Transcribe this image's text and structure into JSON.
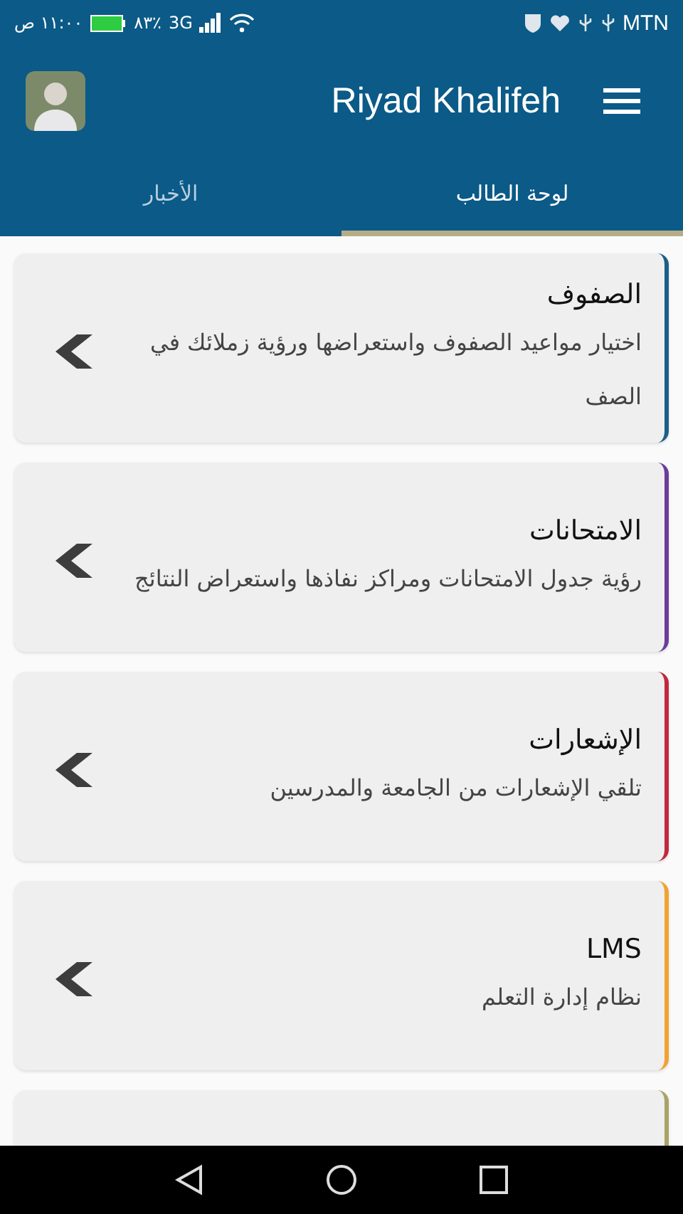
{
  "status_bar": {
    "time": "١١:٠٠ ص",
    "battery": "٨٣٪",
    "network": "3G",
    "carrier": "MTN"
  },
  "header": {
    "title": "Riyad Khalifeh"
  },
  "tabs": [
    {
      "label": "لوحة الطالب",
      "selected": true
    },
    {
      "label": "الأخبار",
      "selected": false
    }
  ],
  "cards": [
    {
      "title": "الصفوف",
      "description": "اختيار مواعيد الصفوف واستعراضها ورؤية زملائك في الصف",
      "color": "#1b5f87"
    },
    {
      "title": "الامتحانات",
      "description": "رؤية جدول الامتحانات ومراكز نفاذها واستعراض النتائج",
      "color": "#6b3d99"
    },
    {
      "title": "الإشعارات",
      "description": "تلقي الإشعارات من الجامعة والمدرسين",
      "color": "#c2283d"
    },
    {
      "title": "LMS",
      "description": "نظام إدارة التعلم",
      "color": "#f0a332"
    },
    {
      "color": "#aaa266"
    }
  ]
}
